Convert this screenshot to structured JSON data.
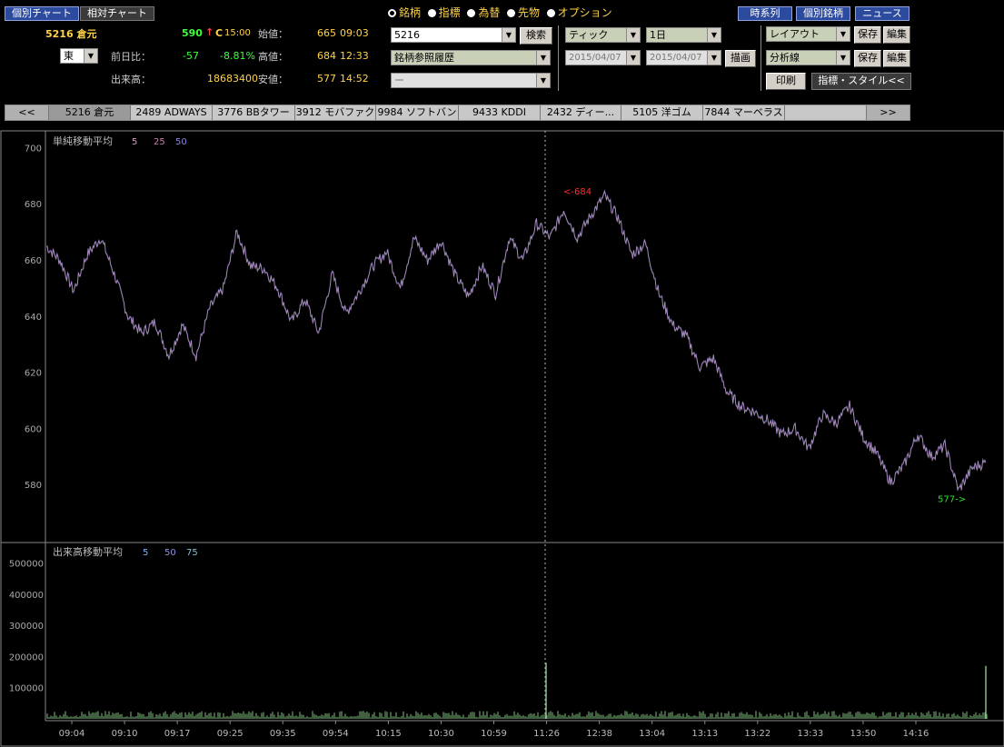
{
  "header": {
    "btn_individual_chart": "個別チャート",
    "btn_relative_chart": "相対チャート",
    "stock_code_name": "5216 倉元",
    "market": "東",
    "price": "590",
    "price_arrow": "↑",
    "price_flag": "C",
    "price_time": "15:00",
    "label_change": "前日比：",
    "change": "-57",
    "change_pct": "-8.81%",
    "label_volume": "出来高：",
    "volume": "18683400",
    "label_open": "始値：",
    "open_value": "665",
    "open_time": "09:03",
    "label_high": "高値：",
    "high_value": "684",
    "high_time": "12:33",
    "label_low": "安値：",
    "low_value": "577",
    "low_time": "14:52"
  },
  "radios": [
    {
      "label": "銘柄",
      "selected": true
    },
    {
      "label": "指標",
      "selected": false
    },
    {
      "label": "為替",
      "selected": false
    },
    {
      "label": "先物",
      "selected": false
    },
    {
      "label": "オプション",
      "selected": false
    }
  ],
  "controls": {
    "symbol_input": "5216",
    "search_button": "検索",
    "history_select": "銘柄参照履歴",
    "third_select": "ー",
    "chart_type": "ティック",
    "period": "1日",
    "date_from": "2015/04/07",
    "date_to": "2015/04/07",
    "draw_button": "描画",
    "layout_select": "レイアウト",
    "analysis_select": "分析線",
    "save_button": "保存",
    "edit_button": "編集",
    "print_button": "印刷",
    "indicator_style_button": "指標・スタイル<<"
  },
  "top_right": {
    "time_series": "時系列",
    "individual_stock": "個別銘柄",
    "news": "ニュース"
  },
  "tabs": {
    "prev": "<<",
    "next": ">>",
    "items": [
      "5216 倉元",
      "2489 ADWAYS",
      "3776 BBタワー",
      "3912 モバファク",
      "9984 ソフトバンク",
      "9433 KDDI",
      "2432 ディー...",
      "5105 洋ゴム",
      "7844 マーベラス",
      ""
    ]
  },
  "colors": {
    "price_line": "#8a7fb8",
    "volume_bar": "#7fbf7f",
    "ma5": "#d4a0c8",
    "ma25": "#c87faa",
    "ma50": "#8888d8",
    "vol_ma5": "#7fb0ff",
    "vol_ma50": "#9090e0",
    "vol_ma75": "#80c0d0",
    "high_marker": "#ff3030",
    "low_marker": "#30e030"
  },
  "chart_data": [
    {
      "type": "line",
      "title": "単純移動平均",
      "legend": [
        "5",
        "25",
        "50"
      ],
      "ylim": [
        560,
        705
      ],
      "yticks": [
        580,
        600,
        620,
        640,
        660,
        680,
        700
      ],
      "x": [
        "09:04",
        "09:10",
        "09:17",
        "09:25",
        "09:35",
        "09:54",
        "10:15",
        "10:30",
        "10:59",
        "11:26",
        "12:38",
        "13:04",
        "13:13",
        "13:22",
        "13:33",
        "13:50",
        "14:16"
      ],
      "series": [
        {
          "values": [
            665,
            660,
            649,
            662,
            668,
            655,
            640,
            634,
            638,
            626,
            637,
            626,
            643,
            650,
            670,
            658,
            657,
            650,
            638,
            646,
            634,
            655,
            641,
            649,
            658,
            663,
            650,
            668,
            660,
            667,
            655,
            647,
            658,
            648,
            668,
            660,
            673,
            668,
            678,
            668,
            676,
            683,
            675,
            662,
            666,
            648,
            637,
            633,
            622,
            625,
            613,
            608,
            606,
            603,
            598,
            600,
            593,
            605,
            602,
            608,
            597,
            591,
            581,
            587,
            598,
            590,
            594,
            578,
            586,
            588
          ]
        }
      ],
      "annotations": [
        {
          "text": "<-684",
          "value": 684,
          "at": "12:33"
        },
        {
          "text": "577->",
          "value": 577,
          "at": "14:52"
        }
      ],
      "crosshair": "11:26"
    },
    {
      "type": "bar",
      "title": "出来高移動平均",
      "legend": [
        "5",
        "50",
        "75"
      ],
      "ylim": [
        0,
        560000
      ],
      "yticks": [
        100000,
        200000,
        300000,
        400000,
        500000
      ],
      "spikes": [
        {
          "at": "11:26",
          "value": 180000
        },
        {
          "at": "15:00",
          "value": 170000
        }
      ],
      "baseline_volume": 15000
    }
  ]
}
